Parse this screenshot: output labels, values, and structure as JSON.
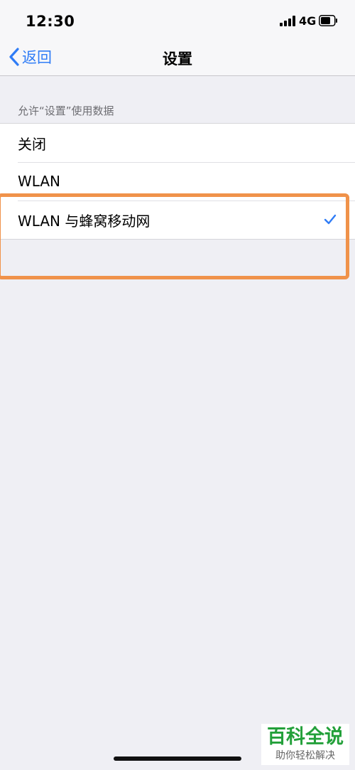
{
  "status_bar": {
    "time": "12:30",
    "network": "4G",
    "icons": [
      "signal-icon",
      "battery-icon"
    ]
  },
  "nav": {
    "back_label": "返回",
    "title": "设置",
    "back_icon": "chevron-left-icon"
  },
  "section": {
    "header": "允许“设置”使用数据"
  },
  "options": [
    {
      "label": "关闭",
      "selected": false
    },
    {
      "label": "WLAN",
      "selected": false
    },
    {
      "label": "WLAN 与蜂窝移动网",
      "selected": true
    }
  ],
  "watermark": {
    "title": "百科全说",
    "subtitle": "助你轻松解决"
  },
  "colors": {
    "accent": "#2f7cf6",
    "highlight": "#f0924a",
    "background": "#efeff4",
    "watermark_green": "#23a03a"
  }
}
